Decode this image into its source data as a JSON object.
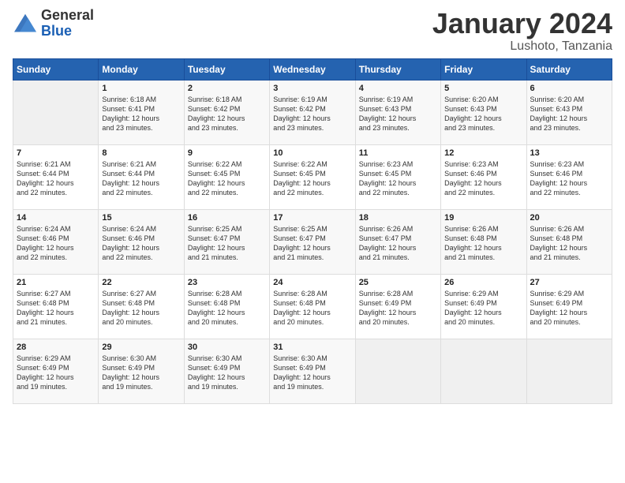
{
  "logo": {
    "general": "General",
    "blue": "Blue"
  },
  "header": {
    "month": "January 2024",
    "location": "Lushoto, Tanzania"
  },
  "weekdays": [
    "Sunday",
    "Monday",
    "Tuesday",
    "Wednesday",
    "Thursday",
    "Friday",
    "Saturday"
  ],
  "weeks": [
    [
      {
        "day": null,
        "info": null
      },
      {
        "day": "1",
        "info": "Sunrise: 6:18 AM\nSunset: 6:41 PM\nDaylight: 12 hours\nand 23 minutes."
      },
      {
        "day": "2",
        "info": "Sunrise: 6:18 AM\nSunset: 6:42 PM\nDaylight: 12 hours\nand 23 minutes."
      },
      {
        "day": "3",
        "info": "Sunrise: 6:19 AM\nSunset: 6:42 PM\nDaylight: 12 hours\nand 23 minutes."
      },
      {
        "day": "4",
        "info": "Sunrise: 6:19 AM\nSunset: 6:43 PM\nDaylight: 12 hours\nand 23 minutes."
      },
      {
        "day": "5",
        "info": "Sunrise: 6:20 AM\nSunset: 6:43 PM\nDaylight: 12 hours\nand 23 minutes."
      },
      {
        "day": "6",
        "info": "Sunrise: 6:20 AM\nSunset: 6:43 PM\nDaylight: 12 hours\nand 23 minutes."
      }
    ],
    [
      {
        "day": "7",
        "info": ""
      },
      {
        "day": "8",
        "info": "Sunrise: 6:21 AM\nSunset: 6:44 PM\nDaylight: 12 hours\nand 22 minutes."
      },
      {
        "day": "9",
        "info": "Sunrise: 6:22 AM\nSunset: 6:45 PM\nDaylight: 12 hours\nand 22 minutes."
      },
      {
        "day": "10",
        "info": "Sunrise: 6:22 AM\nSunset: 6:45 PM\nDaylight: 12 hours\nand 22 minutes."
      },
      {
        "day": "11",
        "info": "Sunrise: 6:23 AM\nSunset: 6:45 PM\nDaylight: 12 hours\nand 22 minutes."
      },
      {
        "day": "12",
        "info": "Sunrise: 6:23 AM\nSunset: 6:46 PM\nDaylight: 12 hours\nand 22 minutes."
      },
      {
        "day": "13",
        "info": "Sunrise: 6:23 AM\nSunset: 6:46 PM\nDaylight: 12 hours\nand 22 minutes."
      }
    ],
    [
      {
        "day": "14",
        "info": ""
      },
      {
        "day": "15",
        "info": "Sunrise: 6:24 AM\nSunset: 6:46 PM\nDaylight: 12 hours\nand 22 minutes."
      },
      {
        "day": "16",
        "info": "Sunrise: 6:25 AM\nSunset: 6:47 PM\nDaylight: 12 hours\nand 21 minutes."
      },
      {
        "day": "17",
        "info": "Sunrise: 6:25 AM\nSunset: 6:47 PM\nDaylight: 12 hours\nand 21 minutes."
      },
      {
        "day": "18",
        "info": "Sunrise: 6:26 AM\nSunset: 6:47 PM\nDaylight: 12 hours\nand 21 minutes."
      },
      {
        "day": "19",
        "info": "Sunrise: 6:26 AM\nSunset: 6:48 PM\nDaylight: 12 hours\nand 21 minutes."
      },
      {
        "day": "20",
        "info": "Sunrise: 6:26 AM\nSunset: 6:48 PM\nDaylight: 12 hours\nand 21 minutes."
      }
    ],
    [
      {
        "day": "21",
        "info": ""
      },
      {
        "day": "22",
        "info": "Sunrise: 6:27 AM\nSunset: 6:48 PM\nDaylight: 12 hours\nand 20 minutes."
      },
      {
        "day": "23",
        "info": "Sunrise: 6:28 AM\nSunset: 6:48 PM\nDaylight: 12 hours\nand 20 minutes."
      },
      {
        "day": "24",
        "info": "Sunrise: 6:28 AM\nSunset: 6:48 PM\nDaylight: 12 hours\nand 20 minutes."
      },
      {
        "day": "25",
        "info": "Sunrise: 6:28 AM\nSunset: 6:49 PM\nDaylight: 12 hours\nand 20 minutes."
      },
      {
        "day": "26",
        "info": "Sunrise: 6:29 AM\nSunset: 6:49 PM\nDaylight: 12 hours\nand 20 minutes."
      },
      {
        "day": "27",
        "info": "Sunrise: 6:29 AM\nSunset: 6:49 PM\nDaylight: 12 hours\nand 20 minutes."
      }
    ],
    [
      {
        "day": "28",
        "info": "Sunrise: 6:29 AM\nSunset: 6:49 PM\nDaylight: 12 hours\nand 19 minutes."
      },
      {
        "day": "29",
        "info": "Sunrise: 6:30 AM\nSunset: 6:49 PM\nDaylight: 12 hours\nand 19 minutes."
      },
      {
        "day": "30",
        "info": "Sunrise: 6:30 AM\nSunset: 6:49 PM\nDaylight: 12 hours\nand 19 minutes."
      },
      {
        "day": "31",
        "info": "Sunrise: 6:30 AM\nSunset: 6:49 PM\nDaylight: 12 hours\nand 19 minutes."
      },
      {
        "day": null,
        "info": null
      },
      {
        "day": null,
        "info": null
      },
      {
        "day": null,
        "info": null
      }
    ]
  ],
  "week1_day7_info": "Sunrise: 6:21 AM\nSunset: 6:44 PM\nDaylight: 12 hours\nand 22 minutes.",
  "week2_day14_info": "Sunrise: 6:24 AM\nSunset: 6:46 PM\nDaylight: 12 hours\nand 22 minutes.",
  "week3_day21_info": "Sunrise: 6:27 AM\nSunset: 6:48 PM\nDaylight: 12 hours\nand 21 minutes."
}
